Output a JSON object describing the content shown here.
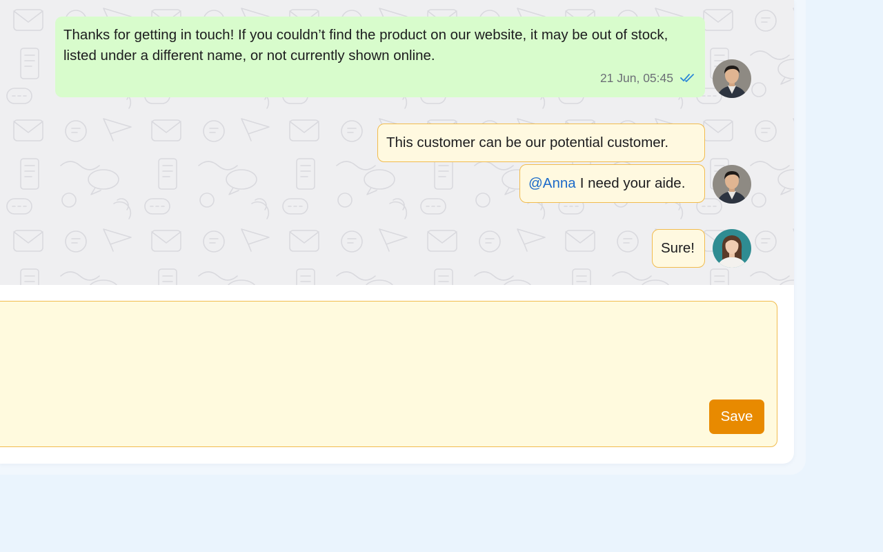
{
  "messages": [
    {
      "type": "agent",
      "text": "Thanks for getting in touch! If you couldn’t find the product on our website, it may be out of stock, listed under a different name, or not currently shown online.",
      "timestamp": "21 Jun, 05:45",
      "status_icon": "double-check-icon",
      "avatar": "avatar-man"
    },
    {
      "type": "note",
      "text": "This customer can be our potential customer."
    },
    {
      "type": "note",
      "mention": "@Anna",
      "text": "I need your aide.",
      "avatar": "avatar-man"
    },
    {
      "type": "note",
      "text": "Sure!",
      "avatar": "avatar-woman"
    }
  ],
  "composer": {
    "value": "",
    "save_label": "Save"
  },
  "colors": {
    "agent_bubble": "#d8fccc",
    "note_bubble": "#fff9e0",
    "note_border": "#f1bb4d",
    "mention": "#1b6ac9",
    "save_button": "#e88a00",
    "read_check": "#2a86d8"
  }
}
